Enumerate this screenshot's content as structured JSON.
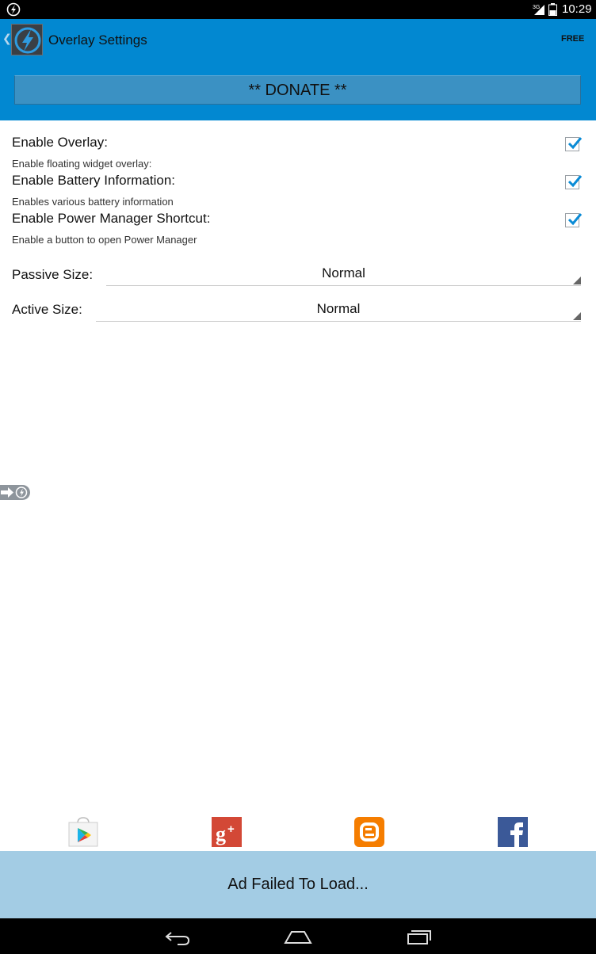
{
  "status_bar": {
    "time": "10:29",
    "network": "3G"
  },
  "action_bar": {
    "title": "Overlay Settings",
    "badge": "FREE"
  },
  "donate": {
    "label": "** DONATE **"
  },
  "settings": [
    {
      "title": "Enable Overlay:",
      "description": "Enable floating widget overlay:",
      "checked": true
    },
    {
      "title": "Enable Battery Information:",
      "description": "Enables various battery information",
      "checked": true
    },
    {
      "title": "Enable Power Manager Shortcut:",
      "description": "Enable a button to open Power Manager",
      "checked": true
    }
  ],
  "sizes": {
    "passive": {
      "label": "Passive Size:",
      "value": "Normal"
    },
    "active": {
      "label": "Active Size:",
      "value": "Normal"
    }
  },
  "social_links": [
    "play-store-icon",
    "google-plus-icon",
    "blogger-icon",
    "facebook-icon"
  ],
  "ad": {
    "text": "Ad Failed To Load..."
  },
  "colors": {
    "action_bar": "#0288d1",
    "donate_button": "#3b91c3",
    "ad_bar": "#a3cce4",
    "checkbox_check": "#0a8bd6"
  }
}
